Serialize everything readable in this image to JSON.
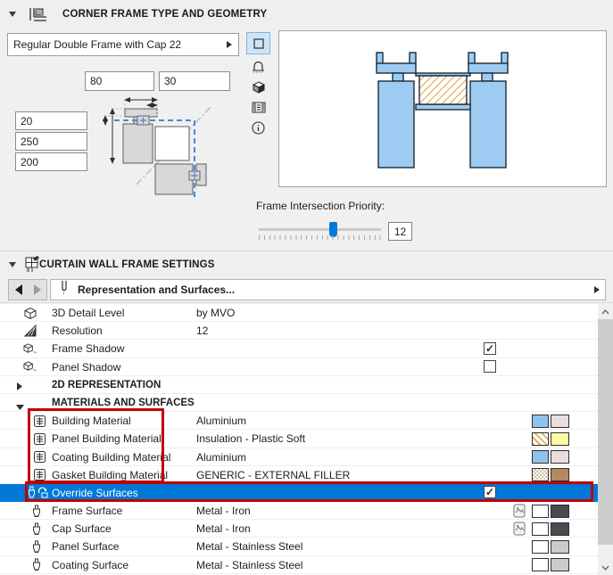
{
  "colors": {
    "selection_blue": "#0078d7",
    "annotation_red": "#c00000",
    "frame_fill_blue": "#9ecbf2",
    "hatch_orange": "#dfa23b"
  },
  "panel1": {
    "title": "CORNER FRAME TYPE AND GEOMETRY",
    "frame_type_value": "Regular Double Frame with Cap 22",
    "inputs": {
      "cap_width": "80",
      "cap_depth": "30",
      "dim1": "20",
      "dim2": "250",
      "dim3": "200"
    },
    "priority_label": "Frame Intersection Priority:",
    "priority_value": "12"
  },
  "panel2": {
    "title": "CURTAIN WALL FRAME SETTINGS",
    "nav_label": "Representation and Surfaces...",
    "rows": [
      {
        "icon": "cube-outline",
        "label": "3D Detail Level",
        "value": "by MVO"
      },
      {
        "icon": "resolution-cone",
        "label": "Resolution",
        "value": "12"
      },
      {
        "icon": "cube-shadow",
        "label": "Frame Shadow",
        "check": "✓"
      },
      {
        "icon": "cube-shadow",
        "label": "Panel Shadow",
        "check": ""
      },
      {
        "group": "collapsed",
        "label": "2D REPRESENTATION"
      },
      {
        "group": "expanded",
        "label": "MATERIALS AND SURFACES"
      },
      {
        "icon": "building-material",
        "label": "Building Material",
        "value": "Aluminium",
        "swatch1": "#8fc3ef",
        "swatch2": "#e8dfdd"
      },
      {
        "icon": "building-material",
        "label": "Panel Building Material",
        "value": "Insulation - Plastic Soft",
        "swatch1": "hatch-orange",
        "swatch2": "#fbf9a3"
      },
      {
        "icon": "building-material",
        "label": "Coating Building Material",
        "value": "Aluminium",
        "swatch1": "#8fc3ef",
        "swatch2": "#e8dfdd"
      },
      {
        "icon": "building-material",
        "label": "Gasket Building Material",
        "value": "GENERIC - EXTERNAL FILLER",
        "swatch1": "hatch-dots",
        "swatch2": "#b3895f"
      },
      {
        "icon": "override-surfaces",
        "label": "Override Surfaces",
        "check": "✓",
        "selected": true
      },
      {
        "icon": "paintbrush",
        "label": "Frame Surface",
        "value": "Metal - Iron",
        "texture": true,
        "swatch1": "#ffffff",
        "swatch2": "#474c52"
      },
      {
        "icon": "paintbrush",
        "label": "Cap Surface",
        "value": "Metal - Iron",
        "texture": true,
        "swatch1": "#ffffff",
        "swatch2": "#474c52"
      },
      {
        "icon": "paintbrush",
        "label": "Panel Surface",
        "value": "Metal - Stainless Steel",
        "swatch1": "#ffffff",
        "swatch2": "#cbcbcb"
      },
      {
        "icon": "paintbrush",
        "label": "Coating Surface",
        "value": "Metal - Stainless Steel",
        "swatch1": "#ffffff",
        "swatch2": "#cbcbcb"
      }
    ]
  }
}
